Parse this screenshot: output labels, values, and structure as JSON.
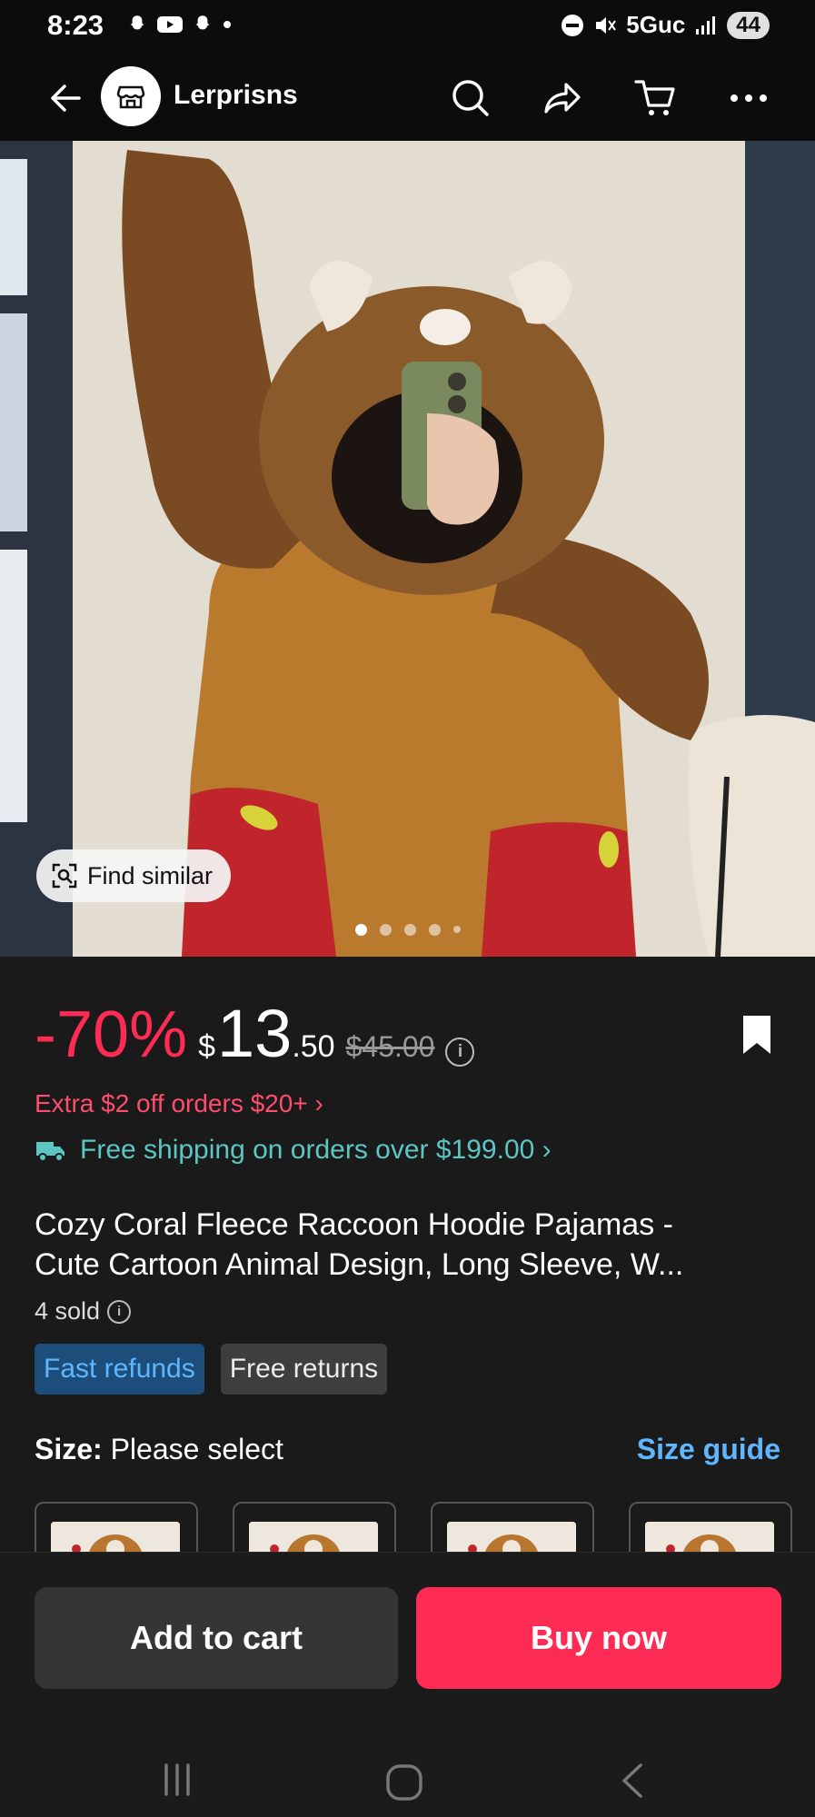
{
  "status_bar": {
    "time": "8:23",
    "network": "5Guc",
    "battery": "44"
  },
  "header": {
    "store_name": "Lerprisns"
  },
  "hero": {
    "find_similar_label": "Find similar",
    "image_count": 5,
    "active_image": 1
  },
  "price": {
    "discount": "-70%",
    "currency": "$",
    "whole": "13",
    "cents": ".50",
    "original": "$45.00"
  },
  "promo": {
    "extra_off": "Extra $2 off orders $20+ ›"
  },
  "shipping": {
    "text": "Free shipping on orders over $199.00 ›"
  },
  "product": {
    "title_line1": "Cozy Coral Fleece Raccoon Hoodie Pajamas -",
    "title_line2": "Cute Cartoon Animal Design, Long Sleeve, W...",
    "sold": "4 sold"
  },
  "tags": [
    "Fast refunds",
    "Free returns"
  ],
  "size": {
    "label": "Size:",
    "value": "Please select",
    "guide": "Size guide"
  },
  "actions": {
    "add_to_cart": "Add to cart",
    "buy_now": "Buy now"
  },
  "colors": {
    "accent": "#fe2c55",
    "link": "#5fb6ff",
    "shipping": "#5cc6c2"
  }
}
